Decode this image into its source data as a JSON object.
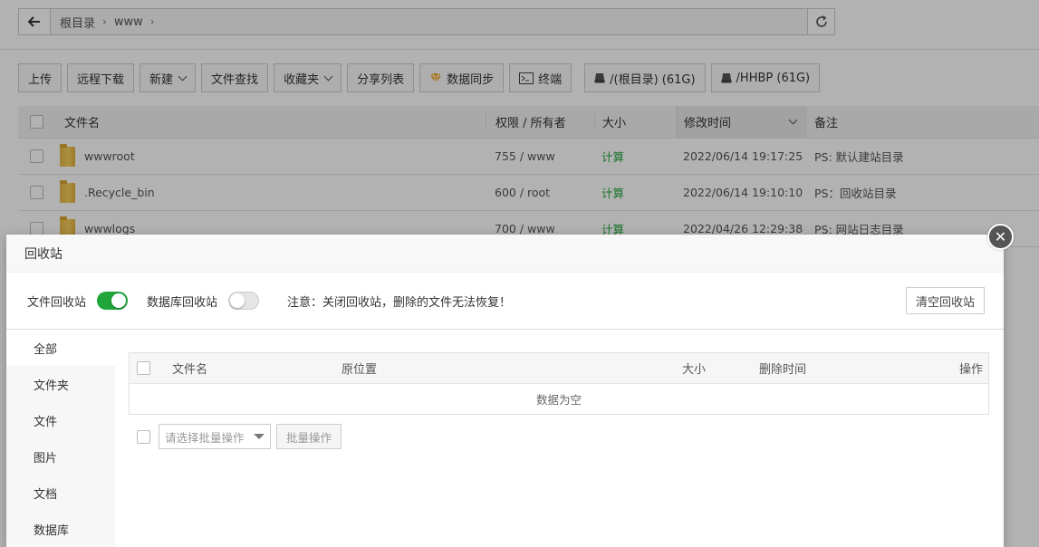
{
  "pathbar": {
    "crumbs": [
      "根目录",
      "www"
    ]
  },
  "toolbar": {
    "upload": "上传",
    "remote_download": "远程下载",
    "new": "新建",
    "find": "文件查找",
    "favorites": "收藏夹",
    "share_list": "分享列表",
    "data_sync": "数据同步",
    "terminal": "终端",
    "disk_root": "/(根目录) (61G)",
    "disk_hhbp": "/HHBP (61G)"
  },
  "file_table": {
    "headers": {
      "name": "文件名",
      "perm": "权限 / 所有者",
      "size": "大小",
      "mtime": "修改时间",
      "note": "备注"
    },
    "rows": [
      {
        "name": "wwwroot",
        "perm": "755 / www",
        "size": "计算",
        "mtime": "2022/06/14 19:17:25",
        "note": "PS: 默认建站目录"
      },
      {
        "name": ".Recycle_bin",
        "perm": "600 / root",
        "size": "计算",
        "mtime": "2022/06/14 19:10:10",
        "note": "PS：回收站目录"
      },
      {
        "name": "wwwlogs",
        "perm": "700 / www",
        "size": "计算",
        "mtime": "2022/04/26 12:29:38",
        "note": "PS: 网站日志目录"
      }
    ]
  },
  "modal": {
    "title": "回收站",
    "close_glyph": "✕",
    "file_recycle_label": "文件回收站",
    "file_recycle_on": true,
    "db_recycle_label": "数据库回收站",
    "db_recycle_on": false,
    "notice": "注意：关闭回收站，删除的文件无法恢复！",
    "clear_button": "清空回收站",
    "categories": [
      "全部",
      "文件夹",
      "文件",
      "图片",
      "文档",
      "数据库"
    ],
    "active_category": "全部",
    "table": {
      "headers": {
        "name": "文件名",
        "location": "原位置",
        "size": "大小",
        "deleted_at": "删除时间",
        "actions": "操作"
      },
      "empty_text": "数据为空"
    },
    "batch": {
      "select_placeholder": "请选择批量操作",
      "button": "批量操作"
    }
  },
  "colors": {
    "accent_green": "#20a53a"
  }
}
